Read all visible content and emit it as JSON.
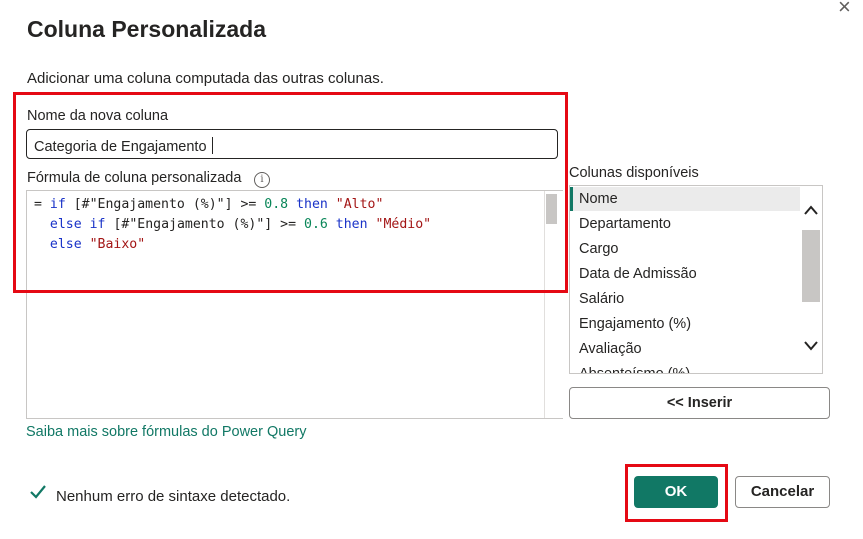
{
  "dialog": {
    "title": "Coluna Personalizada",
    "close_icon": "×",
    "description": "Adicionar uma coluna computada das outras colunas."
  },
  "new_column": {
    "label": "Nome da nova coluna",
    "value": "Categoria de Engajamento"
  },
  "formula": {
    "label": "Fórmula de coluna personalizada",
    "info_icon": "i",
    "lines": [
      [
        {
          "t": "= ",
          "c": "plain"
        },
        {
          "t": "if",
          "c": "kw"
        },
        {
          "t": " [#\"Engajamento (%)\"] >= ",
          "c": "plain"
        },
        {
          "t": "0.8",
          "c": "num"
        },
        {
          "t": " ",
          "c": "plain"
        },
        {
          "t": "then",
          "c": "kw"
        },
        {
          "t": " ",
          "c": "plain"
        },
        {
          "t": "\"Alto\"",
          "c": "str"
        }
      ],
      [
        {
          "t": "  ",
          "c": "plain"
        },
        {
          "t": "else",
          "c": "kw"
        },
        {
          "t": " ",
          "c": "plain"
        },
        {
          "t": "if",
          "c": "kw"
        },
        {
          "t": " [#\"Engajamento (%)\"] >= ",
          "c": "plain"
        },
        {
          "t": "0.6",
          "c": "num"
        },
        {
          "t": " ",
          "c": "plain"
        },
        {
          "t": "then",
          "c": "kw"
        },
        {
          "t": " ",
          "c": "plain"
        },
        {
          "t": "\"Médio\"",
          "c": "str"
        }
      ],
      [
        {
          "t": "  ",
          "c": "plain"
        },
        {
          "t": "else",
          "c": "kw"
        },
        {
          "t": " ",
          "c": "plain"
        },
        {
          "t": "\"Baixo\"",
          "c": "str"
        }
      ]
    ]
  },
  "available_columns": {
    "label": "Colunas disponíveis",
    "items": [
      "Nome",
      "Departamento",
      "Cargo",
      "Data de Admissão",
      "Salário",
      "Engajamento (%)",
      "Avaliação",
      "Absenteísmo (%)"
    ],
    "selected": "Nome",
    "scroll_up_icon": "chevron-up-icon",
    "scroll_down_icon": "chevron-down-icon"
  },
  "insert_button": "<< Inserir",
  "learn_more_link": "Saiba mais sobre fórmulas do Power Query",
  "syntax_status": "Nenhum erro de sintaxe detectado.",
  "ok_button": "OK",
  "cancel_button": "Cancelar",
  "colors": {
    "accent": "#117865",
    "highlight_box": "#e50914",
    "keyword": "#1a33c8",
    "number": "#098658",
    "string": "#a31515"
  }
}
